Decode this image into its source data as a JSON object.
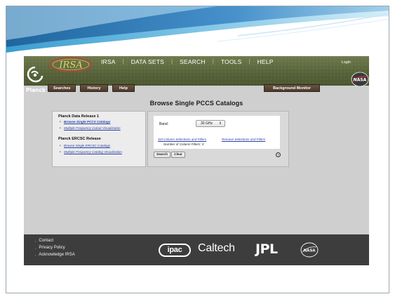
{
  "header": {
    "logo_text": "IRSA",
    "nav": [
      "IRSA",
      "Data Sets",
      "Search",
      "Tools",
      "Help"
    ],
    "login": "Login",
    "planck_text": "Planck",
    "nasa_text": "NASA"
  },
  "subnav": {
    "tabs": [
      "Searches",
      "History",
      "Help"
    ],
    "background_monitor": "Background Monitor"
  },
  "page": {
    "title": "Browse Single PCCS Catalogs"
  },
  "sidebar": {
    "section1_title": "Planck Data Release 1",
    "section1_links": [
      "Browse Single PCCS Catalogs",
      "Multiple Frequency Cutout Visualization"
    ],
    "section2_title": "Planck ERCSC Release",
    "section2_links": [
      "Browse Single ERCSC Catalogs",
      "Multiple Frequency Catalog Visualization"
    ]
  },
  "form": {
    "band_label": "Band:",
    "band_value": "30 GHz",
    "set_filters_link": "Set Column Selections and Filters",
    "remove_filters_link": "Remove Selections and Filters",
    "filters_count": "Number of Column Filters: 0",
    "search_button": "Search",
    "clear_button": "Clear",
    "help_icon": "?"
  },
  "footer": {
    "links": [
      "Contact",
      "Privacy Policy",
      "Acknowledge IRSA"
    ],
    "logos": [
      "ipac",
      "Caltech",
      "JPL",
      "NASA"
    ]
  }
}
